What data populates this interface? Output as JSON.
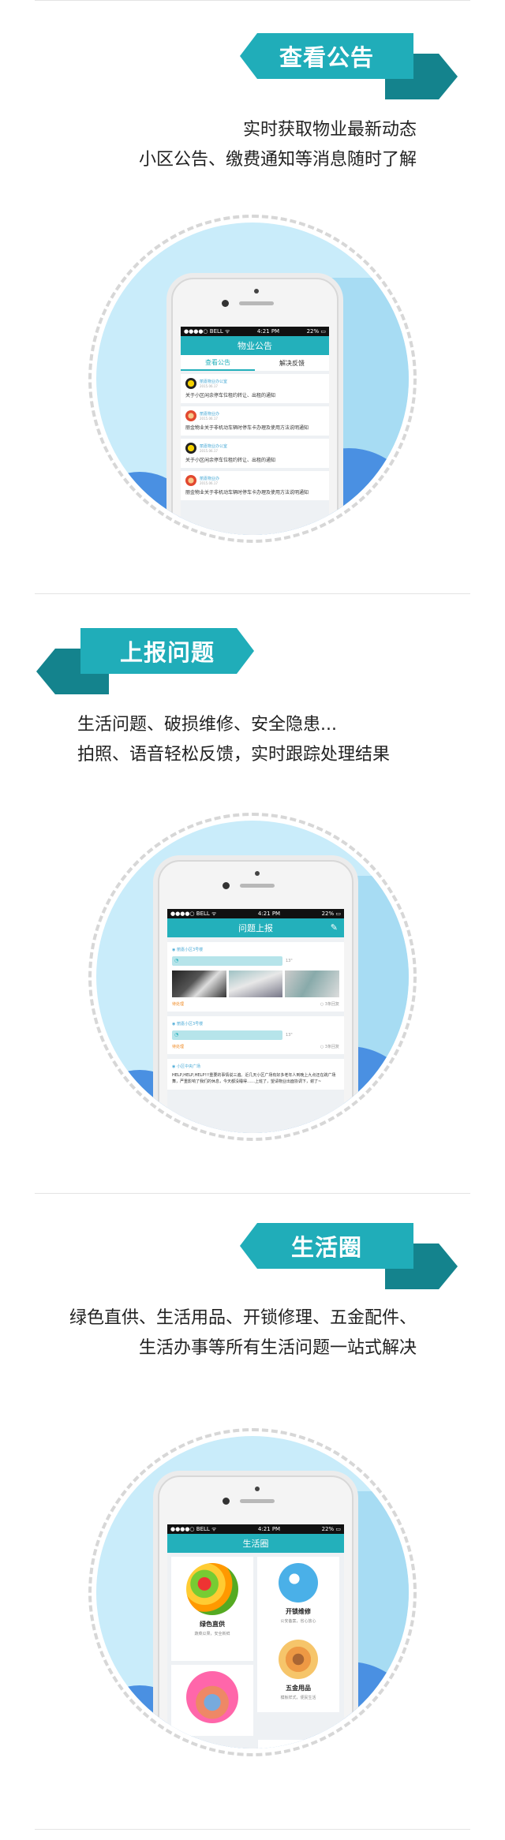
{
  "sections": [
    {
      "banner": "查看公告",
      "lines": [
        "实时获取物业最新动态",
        "小区公告、缴费通知等消息随时了解"
      ],
      "phone": {
        "status": {
          "carrier": "●●●●○ BELL ᯤ",
          "time": "4:21 PM",
          "battery": "22% ▭"
        },
        "title": "物业公告",
        "tabs": [
          "查看公告",
          "解决反馈"
        ],
        "notices": [
          {
            "source": "丽嘉物业办公室",
            "date": "2015.06.17",
            "text": "关于小区闲余停车位租约转让、出租的通知"
          },
          {
            "source": "丽嘉物业办",
            "date": "2015.06.17",
            "text": "丽金物业关于非机动车辆时停车卡办理及使用方法说明通知"
          },
          {
            "source": "丽嘉物业办公室",
            "date": "2015.06.17",
            "text": "关于小区闲余停车位租约转让、出租的通知"
          },
          {
            "source": "丽嘉物业办",
            "date": "2015.06.17",
            "text": "丽金物业关于非机动车辆时停车卡办理及使用方法说明通知"
          }
        ]
      }
    },
    {
      "banner": "上报问题",
      "lines": [
        "生活问题、破损维修、安全隐患...",
        "拍照、语音轻松反馈，实时跟踪处理结果"
      ],
      "phone": {
        "status": {
          "carrier": "●●●●○ BELL ᯤ",
          "time": "4:21 PM",
          "battery": "22% ▭"
        },
        "title": "问题上报",
        "edit_icon": "✎",
        "reports": [
          {
            "loc": "◉ 丽嘉小区3号楼",
            "audio": "◔",
            "dur": "13\"",
            "status": "待处理",
            "count": "○ 3条回复"
          },
          {
            "loc": "◉ 丽嘉小区3号楼",
            "audio": "◔",
            "dur": "13\"",
            "status": "待处理",
            "count": "○ 3条回复"
          },
          {
            "loc": "◉ 小区中央广场",
            "text": "HELP,HELP,HELP!!!重要的事情说三遍。近几天小区广场有好多老年人到晚上九点还在跳广场舞，严重影响了我们的休息，今天都没睡得……上班了，望请物业出面协调下，谢了~"
          }
        ]
      }
    },
    {
      "banner": "生活圈",
      "lines": [
        "绿色直供、生活用品、开锁修理、五金配件、",
        "生活办事等所有生活问题一站式解决"
      ],
      "phone": {
        "status": {
          "carrier": "●●●●○ BELL ᯤ",
          "time": "4:21 PM",
          "battery": "22% ▭"
        },
        "title": "生活圈",
        "tiles": [
          {
            "title": "绿色直供",
            "sub": "蔬菜瓜果，安全新鲜"
          },
          {
            "title": "开锁维修",
            "sub": "公安备案，省心放心"
          },
          {
            "title": "五金用品",
            "sub": "模板样式，便民生活"
          },
          {
            "title": "",
            "sub": ""
          },
          {
            "title": "",
            "sub": ""
          }
        ]
      }
    }
  ],
  "colors": {
    "teal": "#20adb9",
    "teal_dark": "#14838d",
    "sky": "#c9ecfa",
    "cloud": "#4a90e2"
  }
}
